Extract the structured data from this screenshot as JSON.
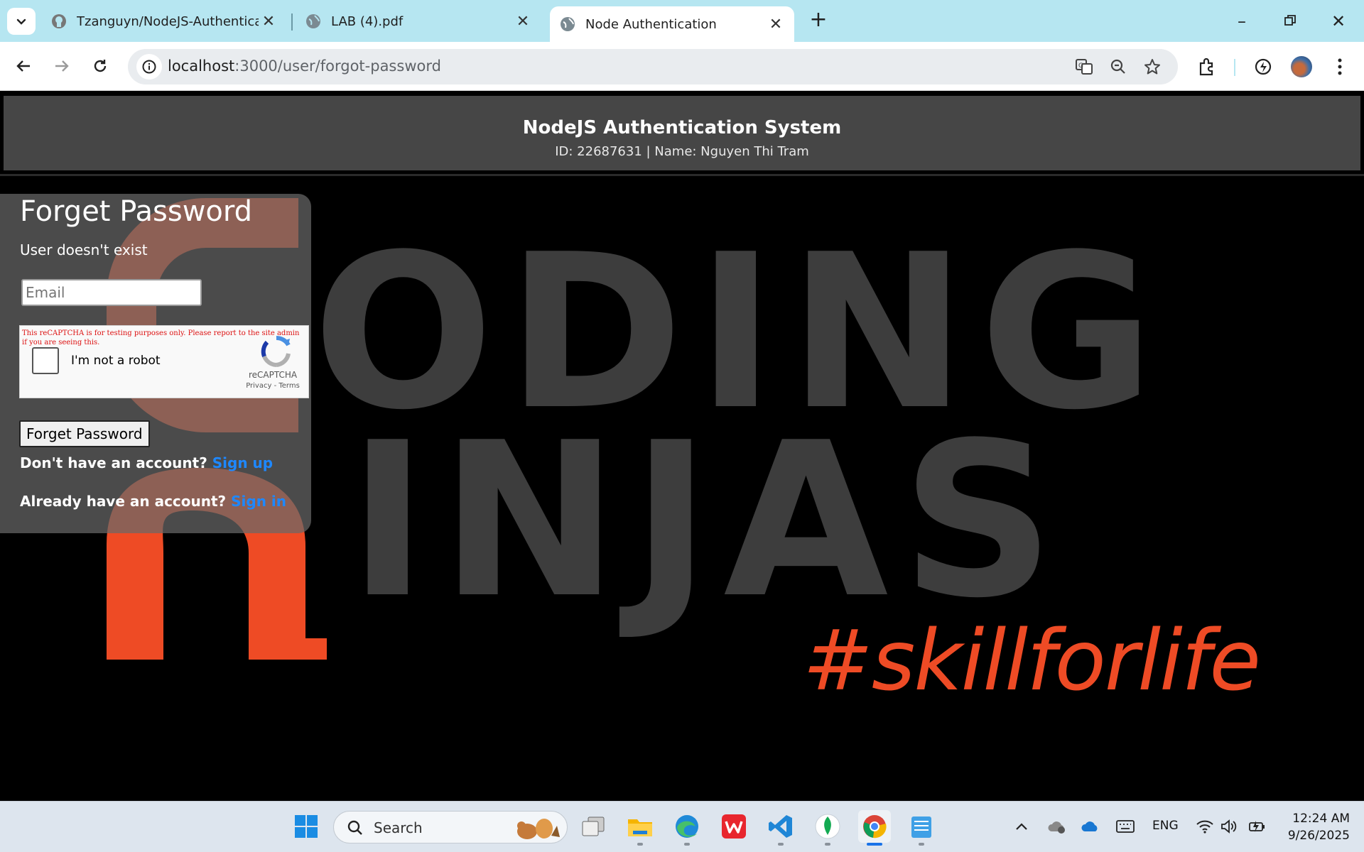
{
  "browser": {
    "tabs": [
      {
        "title": "Tzanguyn/NodeJS-Authenticati",
        "icon": "github-icon"
      },
      {
        "title": "LAB (4).pdf",
        "icon": "globe-icon"
      },
      {
        "title": "Node Authentication",
        "icon": "globe-icon",
        "active": true
      }
    ],
    "url_host": "localhost",
    "url_path": ":3000/user/forgot-password"
  },
  "header": {
    "title": "NodeJS Authentication System",
    "subtitle": "ID: 22687631 | Name: Nguyen Thi Tram"
  },
  "background": {
    "word1": "ODING",
    "word2": "INJAS",
    "tagline": "#skillforlife",
    "accent": "#ee4b25"
  },
  "form": {
    "title": "Forget Password",
    "message": "User doesn't exist",
    "email_placeholder": "Email",
    "captcha_warning": "This reCAPTCHA is for testing purposes only. Please report to the site admin if you are seeing this.",
    "captcha_label": "I'm not a robot",
    "captcha_brand": "reCAPTCHA",
    "captcha_terms": "Privacy - Terms",
    "submit_label": "Forget Password",
    "signup_prompt": "Don't have an account?",
    "signup_link": "Sign up",
    "signin_prompt": "Already have an account?",
    "signin_link": "Sign in"
  },
  "taskbar": {
    "search_label": "Search",
    "language": "ENG",
    "time": "12:24 AM",
    "date": "9/26/2025"
  }
}
